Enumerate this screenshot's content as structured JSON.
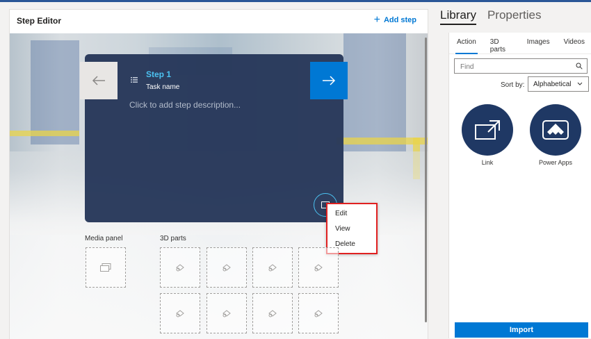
{
  "editor": {
    "title": "Step Editor",
    "add_step_label": "Add step"
  },
  "card": {
    "step_title": "Step 1",
    "task_name": "Task name",
    "description_placeholder": "Click to add step description..."
  },
  "context_menu": {
    "items": [
      "Edit",
      "View",
      "Delete"
    ]
  },
  "panels": {
    "media_label": "Media panel",
    "parts_label": "3D parts"
  },
  "right_panel": {
    "tabs": [
      "Library",
      "Properties"
    ],
    "active_tab": "Library",
    "sub_tabs": [
      "Action",
      "3D parts",
      "Images",
      "Videos"
    ],
    "active_sub_tab": "Action",
    "search_placeholder": "Find",
    "sort_label": "Sort by:",
    "sort_value": "Alphabetical",
    "tiles": [
      {
        "label": "Link",
        "icon": "external-link-icon"
      },
      {
        "label": "Power Apps",
        "icon": "power-apps-icon"
      }
    ],
    "import_label": "Import"
  },
  "colors": {
    "accent": "#0078d4",
    "card_bg": "#27385a",
    "step_title": "#4cc2f1",
    "tile_bg": "#1f3864",
    "highlight_border": "#e02020"
  }
}
